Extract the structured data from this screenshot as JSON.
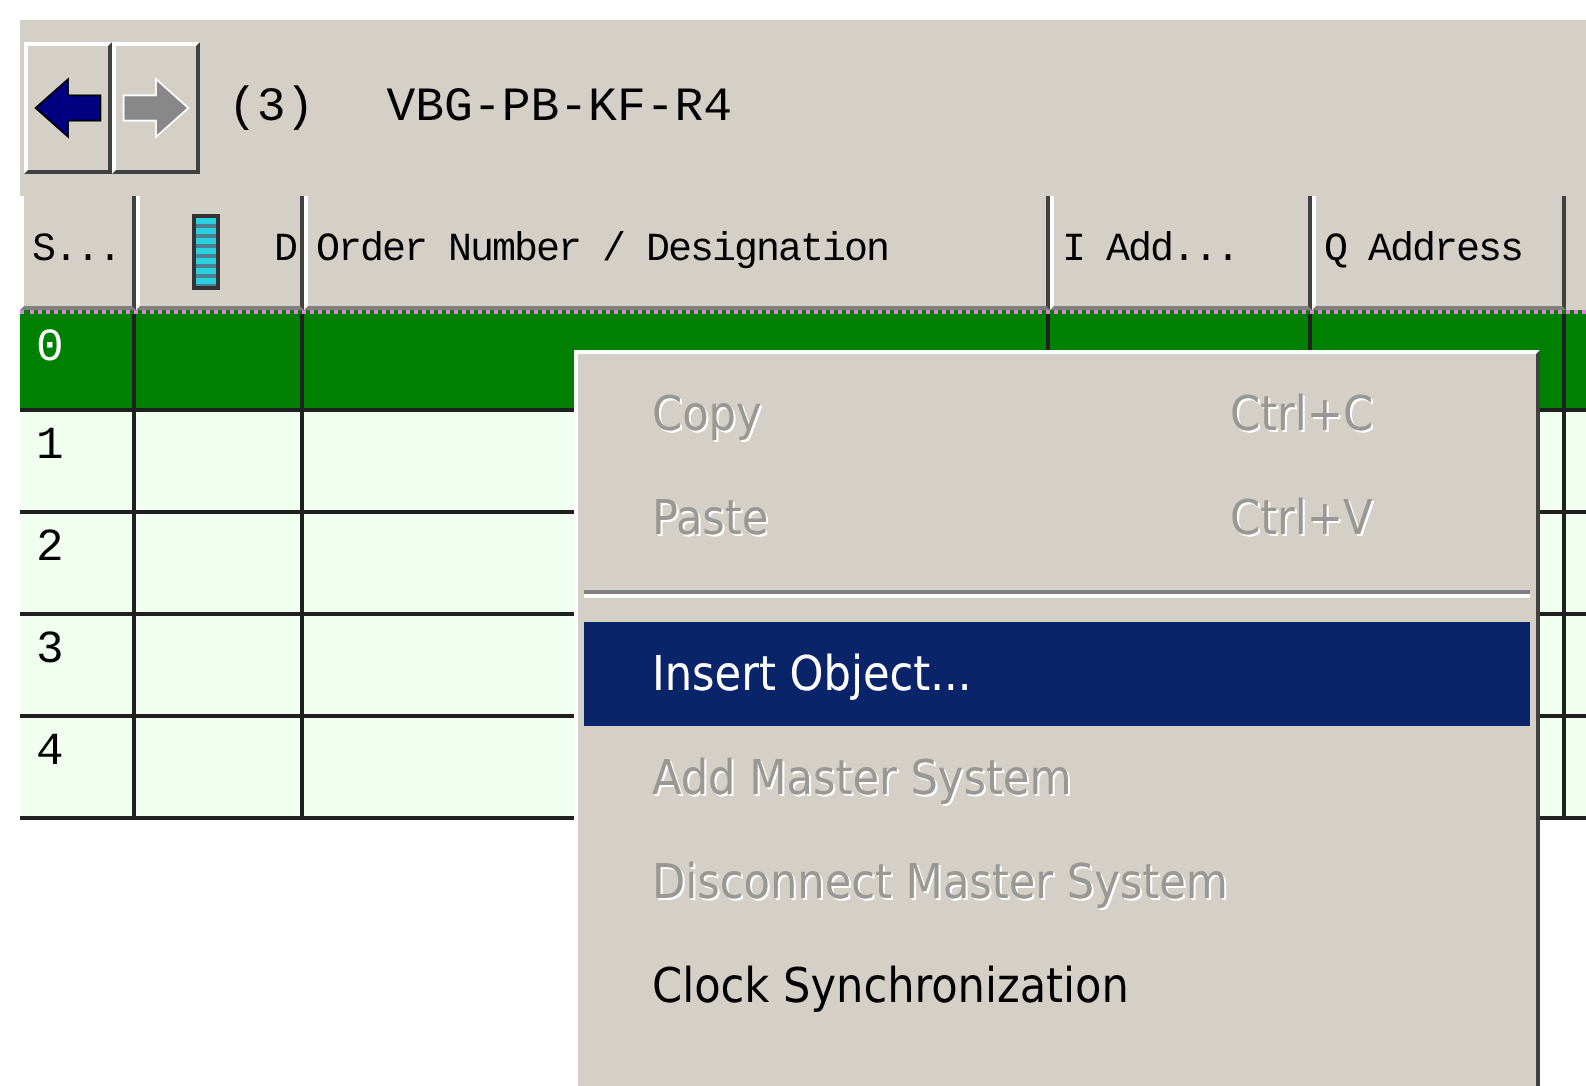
{
  "toolbar": {
    "buttons": [
      {
        "kind": "back",
        "disabled": false
      },
      {
        "kind": "forward",
        "disabled": true
      }
    ],
    "station_number": "(3)",
    "station_name": "VBG-PB-KF-R4"
  },
  "table": {
    "columns": [
      {
        "label": "S..."
      },
      {
        "label": "D",
        "kind": "icon"
      },
      {
        "label": "Order Number / Designation"
      },
      {
        "label": "I Add..."
      },
      {
        "label": "Q Address"
      }
    ],
    "rows": [
      {
        "slot": "0",
        "selected": true
      },
      {
        "slot": "1",
        "selected": false
      },
      {
        "slot": "2",
        "selected": false
      },
      {
        "slot": "3",
        "selected": false
      },
      {
        "slot": "4",
        "selected": false
      }
    ]
  },
  "context_menu": {
    "items": [
      {
        "kind": "item",
        "label": "Copy",
        "shortcut": "Ctrl+C",
        "disabled": true,
        "selected": false
      },
      {
        "kind": "item",
        "label": "Paste",
        "shortcut": "Ctrl+V",
        "disabled": true,
        "selected": false
      },
      {
        "kind": "separator"
      },
      {
        "kind": "item",
        "label": "Insert Object...",
        "disabled": false,
        "selected": true
      },
      {
        "kind": "item",
        "label": "Add Master System",
        "disabled": true,
        "selected": false
      },
      {
        "kind": "item",
        "label": "Disconnect Master System",
        "disabled": true,
        "selected": false
      },
      {
        "kind": "item",
        "label": "Clock Synchronization",
        "disabled": false,
        "selected": false
      }
    ]
  }
}
